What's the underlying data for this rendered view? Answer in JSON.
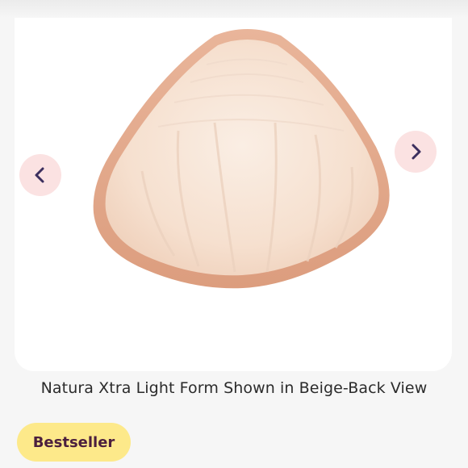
{
  "carousel": {
    "image_alt": "Natura Xtra Light Form Shown in Beige-Back View",
    "prev_icon": "chevron-left-icon",
    "next_icon": "chevron-right-icon"
  },
  "caption": "Natura Xtra Light Form Shown in Beige-Back View",
  "badge": {
    "label": "Bestseller"
  },
  "colors": {
    "nav_bg": "#fbe2e2",
    "nav_icon": "#3c2f5e",
    "badge_bg": "#fde98a",
    "badge_text": "#4b1f3e",
    "product_rim": "#e6ab8c",
    "product_fill": "#f7e2d2"
  }
}
